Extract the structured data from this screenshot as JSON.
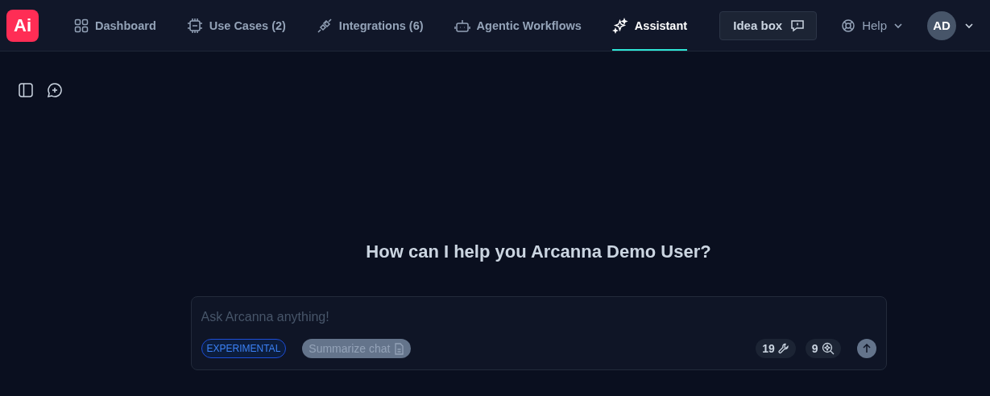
{
  "logo": {
    "text": "Ai"
  },
  "nav": [
    {
      "label": "Dashboard",
      "selected": false
    },
    {
      "label": "Use Cases (2)",
      "selected": false
    },
    {
      "label": "Integrations (6)",
      "selected": false
    },
    {
      "label": "Agentic Workflows",
      "selected": false
    },
    {
      "label": "Assistant",
      "selected": true
    }
  ],
  "idea_box": {
    "label": "Idea box"
  },
  "help": {
    "label": "Help"
  },
  "avatar": {
    "initials": "AD"
  },
  "greeting": "How can I help you Arcanna Demo User?",
  "composer": {
    "placeholder": "Ask Arcanna anything!",
    "badge": "EXPERIMENTAL",
    "summarize": {
      "label": "Summarize chat",
      "disabled": true
    },
    "tools_count": "19",
    "sources_count": "9",
    "send_disabled": true
  }
}
